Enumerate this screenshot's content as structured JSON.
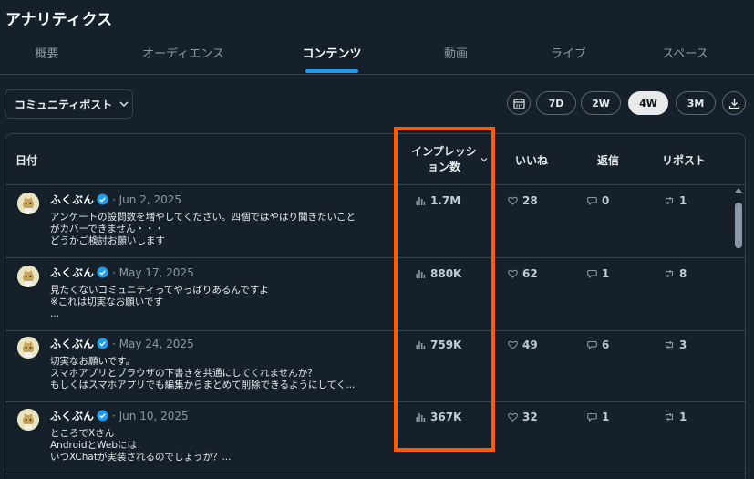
{
  "page": {
    "title": "アナリティクス"
  },
  "tabs": [
    {
      "label": "概要",
      "active": false
    },
    {
      "label": "オーディエンス",
      "active": false
    },
    {
      "label": "コンテンツ",
      "active": true
    },
    {
      "label": "動画",
      "active": false
    },
    {
      "label": "ライブ",
      "active": false
    },
    {
      "label": "スペース",
      "active": false
    }
  ],
  "toolbar": {
    "dropdown_label": "コミュニティポスト",
    "ranges": [
      "7D",
      "2W",
      "4W",
      "3M"
    ],
    "active_range": "4W"
  },
  "table": {
    "headers": {
      "date": "日付",
      "impressions_line1": "インプレッシ",
      "impressions_line2": "ョン数",
      "likes": "いいね",
      "replies": "返信",
      "reposts": "リポスト"
    },
    "rows": [
      {
        "author": "ふくぶん",
        "date": "· Jun 2, 2025",
        "text": "アンケートの設問数を増やしてください。四個ではやはり聞きたいこと\nがカバーできません・・・\nどうかご検討お願いします",
        "impressions": "1.7M",
        "likes": "28",
        "replies": "0",
        "reposts": "1"
      },
      {
        "author": "ふくぶん",
        "date": "· May 17, 2025",
        "text": "見たくないコミュニティってやっぱりあるんですよ\n※これは切実なお願いです\n    ...",
        "impressions": "880K",
        "likes": "62",
        "replies": "1",
        "reposts": "8"
      },
      {
        "author": "ふくぶん",
        "date": "· May 24, 2025",
        "text": "切実なお願いです。\nスマホアプリとブラウザの下書きを共通にしてくれませんか？\nもしくはスマホアプリでも編集からまとめて削除できるようにしてく...",
        "impressions": "759K",
        "likes": "49",
        "replies": "6",
        "reposts": "3"
      },
      {
        "author": "ふくぶん",
        "date": "· Jun 10, 2025",
        "text": "ところでXさん\nAndroidとWebには\nいつXChatが実装されるのでしょうか？...",
        "impressions": "367K",
        "likes": "32",
        "replies": "1",
        "reposts": "1"
      }
    ]
  },
  "colors": {
    "background": "#15202b",
    "accent": "#1d9bf0",
    "highlight": "#ff5a00",
    "border": "#38444d"
  }
}
